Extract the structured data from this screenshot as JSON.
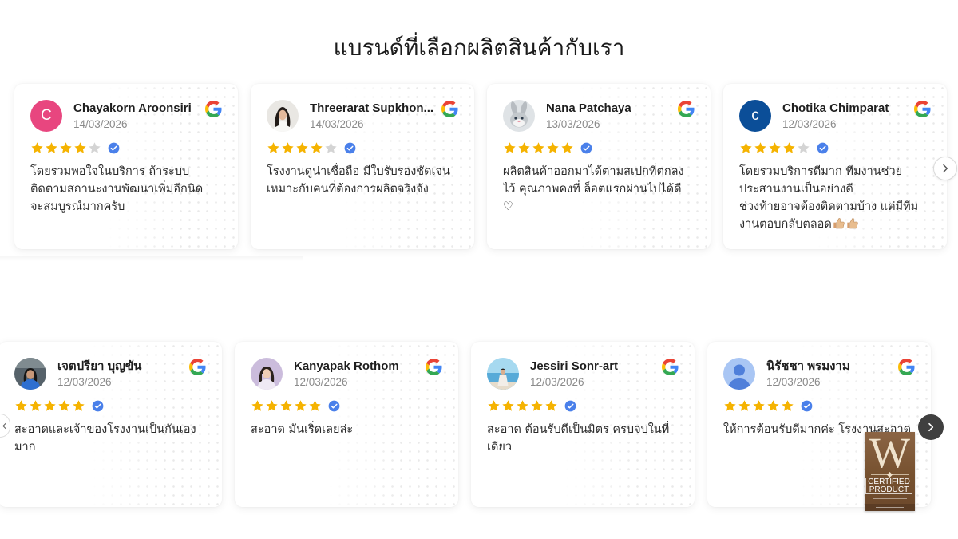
{
  "section": {
    "title": "แบรนด์ที่เลือกผลิตสินค้ากับเรา"
  },
  "colors": {
    "star_filled": "#f5b301",
    "star_empty": "#d4d4d4",
    "verified": "#4a80ea",
    "nav_dark": "#3f3f3f",
    "badge_brown": "#76512f"
  },
  "icons": {
    "source": "google-icon",
    "verified": "verified-icon",
    "next": "chevron-right-icon",
    "prev": "chevron-left-icon"
  },
  "rows": [
    {
      "reviews": [
        {
          "name": "Chayakorn Aroonsiri",
          "date": "14/03/2026",
          "rating": 4,
          "verified": true,
          "avatar": {
            "type": "initial",
            "letter": "C",
            "color": "#e8467f"
          },
          "text_lines": [
            "โดยรวมพอใจในบริการ ถ้าระบบ",
            "ติดตามสถานะงานพัฒนาเพิ่มอีกนิด",
            "จะสมบูรณ์มากครับ"
          ]
        },
        {
          "name": "Threerarat Supkhon...",
          "date": "14/03/2026",
          "rating": 4,
          "verified": true,
          "avatar": {
            "type": "photo"
          },
          "text_lines": [
            "โรงงานดูน่าเชื่อถือ มีใบรับรองชัดเจน",
            "เหมาะกับคนที่ต้องการผลิตจริงจัง"
          ]
        },
        {
          "name": "Nana Patchaya",
          "date": "13/03/2026",
          "rating": 5,
          "verified": true,
          "avatar": {
            "type": "photo"
          },
          "text_lines": [
            "ผลิตสินค้าออกมาได้ตามสเปกที่ตกลง",
            "ไว้ คุณภาพคงที่ ล็อตแรกผ่านไปได้ดี",
            "♡"
          ]
        },
        {
          "name": "Chotika Chimparat",
          "date": "12/03/2026",
          "rating": 4,
          "verified": true,
          "avatar": {
            "type": "initial",
            "letter": "c",
            "color": "#0b4e98"
          },
          "text_lines": [
            "โดยรวมบริการดีมาก ทีมงานช่วย",
            "ประสานงานเป็นอย่างดี",
            "ช่วงท้ายอาจต้องติดตามบ้าง แต่มีทีม",
            "งานตอบกลับตลอด"
          ],
          "trailing_icons": [
            "thumbs-up-icon",
            "thumbs-up-icon"
          ]
        }
      ]
    },
    {
      "reviews": [
        {
          "name": "เจตปรียา บุญขัน",
          "date": "12/03/2026",
          "rating": 5,
          "verified": true,
          "avatar": {
            "type": "photo"
          },
          "text_lines": [
            "สะอาดและเจ้าของโรงงานเป็นกันเอง",
            "มาก"
          ]
        },
        {
          "name": "Kanyapak Rothom",
          "date": "12/03/2026",
          "rating": 5,
          "verified": true,
          "avatar": {
            "type": "photo"
          },
          "text_lines": [
            "สะอาด มันเริ่ดเลยล่ะ"
          ]
        },
        {
          "name": "Jessiri Sonr-art",
          "date": "12/03/2026",
          "rating": 5,
          "verified": true,
          "avatar": {
            "type": "photo"
          },
          "text_lines": [
            "สะอาด ต้อนรับดีเป็นมิตร ครบจบในที่",
            "เดียว"
          ]
        },
        {
          "name": "นิรัชชา พรมงาม",
          "date": "12/03/2026",
          "rating": 5,
          "verified": true,
          "avatar": {
            "type": "default"
          },
          "text_lines": [
            "ให้การต้อนรับดีมากค่ะ โรงงานสะอาด"
          ]
        }
      ]
    }
  ],
  "badge": {
    "monogram": "W",
    "line1": "CERTIFIED",
    "line2": "PRODUCT"
  }
}
